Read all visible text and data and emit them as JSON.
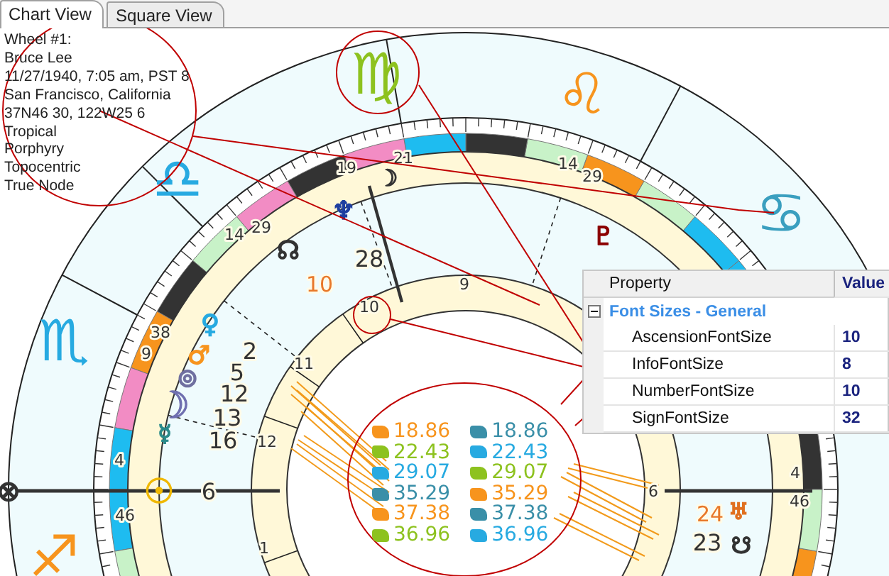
{
  "tabs": [
    {
      "label": "Chart View",
      "selected": true
    },
    {
      "label": "Square View",
      "selected": false
    }
  ],
  "chart_info": [
    "Wheel #1:",
    "Bruce Lee",
    "11/27/1940, 7:05 am, PST 8",
    "San Francisco, California",
    "37N46 30, 122W25 6",
    "Tropical",
    "Porphyry",
    "Topocentric",
    "True Node"
  ],
  "chart": {
    "sign_glyphs": [
      {
        "glyph": "♍",
        "color": "#8dc21f"
      },
      {
        "glyph": "♌",
        "color": "#f7941d"
      },
      {
        "glyph": "♎",
        "color": "#27aae1"
      },
      {
        "glyph": "♋",
        "color": "#3a9fbf"
      },
      {
        "glyph": "♏",
        "color": "#27aae1"
      },
      {
        "glyph": "♐",
        "color": "#f7941d"
      }
    ],
    "planets": [
      {
        "glyph": "☽",
        "color": "#333333"
      },
      {
        "glyph": "♆",
        "color": "#1f3fa0"
      },
      {
        "glyph": "☊",
        "color": "#333333"
      },
      {
        "glyph": "♇",
        "color": "#8b0000"
      },
      {
        "glyph": "♀",
        "color": "#27aae1"
      },
      {
        "glyph": "♂",
        "color": "#f7941d"
      },
      {
        "glyph": "⊚",
        "color": "#7070a0"
      },
      {
        "glyph": "☽",
        "color": "#7070b0"
      },
      {
        "glyph": "☿",
        "color": "#2a8a8a"
      },
      {
        "glyph": "⊗",
        "color": "#333333"
      },
      {
        "glyph": "☉",
        "color": "#f0b800"
      },
      {
        "glyph": "♅",
        "color": "#e07020"
      },
      {
        "glyph": "☋",
        "color": "#333333"
      }
    ],
    "labels": [
      {
        "text": "21",
        "kind": "degree"
      },
      {
        "text": "19",
        "kind": "degree"
      },
      {
        "text": "14",
        "kind": "degree"
      },
      {
        "text": "29",
        "kind": "degree"
      },
      {
        "text": "14",
        "kind": "degree"
      },
      {
        "text": "29",
        "kind": "degree"
      },
      {
        "text": "9",
        "kind": "degree"
      },
      {
        "text": "38",
        "kind": "degree"
      },
      {
        "text": "4",
        "kind": "degree"
      },
      {
        "text": "46",
        "kind": "degree"
      },
      {
        "text": "28",
        "kind": "planet"
      },
      {
        "text": "10",
        "kind": "accent"
      },
      {
        "text": "10",
        "kind": "house"
      },
      {
        "text": "2",
        "kind": "planet"
      },
      {
        "text": "5",
        "kind": "planet"
      },
      {
        "text": "12",
        "kind": "planet"
      },
      {
        "text": "13",
        "kind": "planet"
      },
      {
        "text": "16",
        "kind": "planet"
      },
      {
        "text": "6",
        "kind": "planet"
      },
      {
        "text": "11",
        "kind": "house"
      },
      {
        "text": "12",
        "kind": "house"
      },
      {
        "text": "1",
        "kind": "house"
      },
      {
        "text": "6",
        "kind": "house"
      },
      {
        "text": "4",
        "kind": "degree"
      },
      {
        "text": "46",
        "kind": "degree"
      },
      {
        "text": "24",
        "kind": "accent"
      },
      {
        "text": "23",
        "kind": "planet"
      },
      {
        "text": "9",
        "kind": "house"
      }
    ],
    "sign_degrees": [
      {
        "value": "18.86",
        "color": "#f7941d"
      },
      {
        "value": "18.86",
        "color": "#3a8fa8"
      },
      {
        "value": "22.43",
        "color": "#8dc21f"
      },
      {
        "value": "22.43",
        "color": "#27aae1"
      },
      {
        "value": "29.07",
        "color": "#27aae1"
      },
      {
        "value": "29.07",
        "color": "#8dc21f"
      },
      {
        "value": "35.29",
        "color": "#3a8fa8"
      },
      {
        "value": "35.29",
        "color": "#f7941d"
      },
      {
        "value": "37.38",
        "color": "#f7941d"
      },
      {
        "value": "37.38",
        "color": "#3a8fa8"
      },
      {
        "value": "36.96",
        "color": "#8dc21f"
      },
      {
        "value": "36.96",
        "color": "#27aae1"
      }
    ]
  },
  "property_grid": {
    "columns": [
      "Property",
      "Value"
    ],
    "category": {
      "label": "Font Sizes - General",
      "expanded": true
    },
    "rows": [
      {
        "name": "AscensionFontSize",
        "value": "10"
      },
      {
        "name": "InfoFontSize",
        "value": "8"
      },
      {
        "name": "NumberFontSize",
        "value": "10"
      },
      {
        "name": "SignFontSize",
        "value": "32"
      }
    ]
  }
}
